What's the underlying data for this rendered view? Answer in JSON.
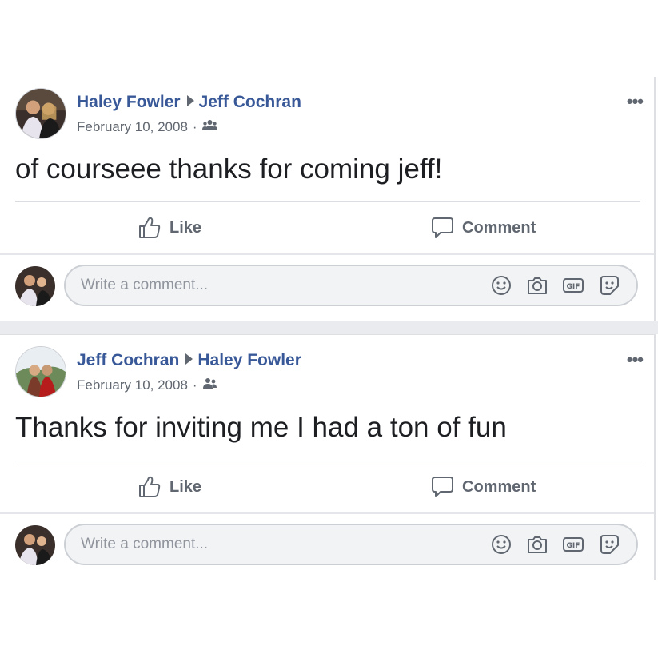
{
  "posts": [
    {
      "author": "Haley Fowler",
      "recipient": "Jeff Cochran",
      "date": "February 10, 2008",
      "separator": "·",
      "audience_icon": "friends-icon",
      "text": "of courseee thanks for coming jeff!",
      "more_label": "•••",
      "like_label": "Like",
      "comment_label": "Comment",
      "comment_placeholder": "Write a comment..."
    },
    {
      "author": "Jeff Cochran",
      "recipient": "Haley Fowler",
      "date": "February 10, 2008",
      "separator": "·",
      "audience_icon": "friends-icon",
      "text": "Thanks for inviting me I had a ton of fun",
      "more_label": "•••",
      "like_label": "Like",
      "comment_label": "Comment",
      "comment_placeholder": "Write a comment..."
    }
  ],
  "comment_tools": [
    "emoji-icon",
    "camera-icon",
    "gif-icon",
    "sticker-icon"
  ],
  "colors": {
    "link": "#385898",
    "secondary_text": "#606770",
    "divider": "#dadde1",
    "feed_gap": "#e9ebee",
    "input_bg": "#f2f3f5"
  }
}
